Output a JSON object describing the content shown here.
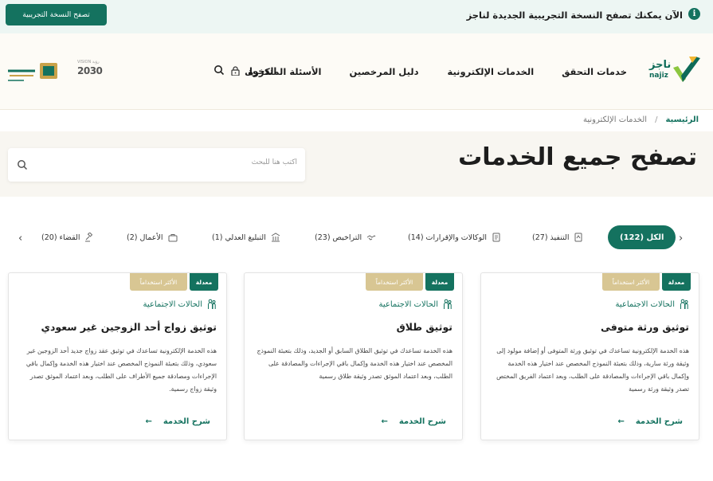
{
  "banner": {
    "text": "الآن يمكنك تصفح النسخة التجريبية الجديدة لناجز",
    "button": "تصفح النسخة التجريبية",
    "info_icon": "info-icon"
  },
  "header": {
    "logo_text": "ناجز",
    "logo_sub": "najiz",
    "nav": [
      "خدمات التحقق",
      "الخدمات الإلكترونية",
      "دليل المرخصين",
      "الأسئلة المتكررة"
    ],
    "login": "الدخول",
    "vision_label": "VISION رؤية",
    "vision_year": "2030",
    "colors": {
      "primary": "#14725f",
      "gold": "#d8c693"
    }
  },
  "breadcrumb": {
    "home": "الرئيسية",
    "separator": "/",
    "current": "الخدمات الإلكترونية"
  },
  "hero": {
    "title": "تصفح جميع الخدمات",
    "search_placeholder": "اكتب هنا للبحث"
  },
  "filters": [
    {
      "label": "الكل (122)",
      "active": true
    },
    {
      "label": "التنفيذ (27)",
      "icon": "execution-icon"
    },
    {
      "label": "الوكالات والإقرارات (14)",
      "icon": "document-icon"
    },
    {
      "label": "التراخيص (23)",
      "icon": "handshake-icon"
    },
    {
      "label": "التبليغ العدلي (1)",
      "icon": "building-icon"
    },
    {
      "label": "الأعمال (2)",
      "icon": "briefcase-icon"
    },
    {
      "label": "القضاء (20)",
      "icon": "gavel-icon"
    }
  ],
  "cards": [
    {
      "badge_modified": "معدلة",
      "badge_most": "الأكثر استخداماً",
      "category": "الحالات الاجتماعية",
      "title": "توثيق ورثة متوفى",
      "description": "هذه الخدمة الإلكترونية تساعدك في توثيق ورثة المتوفى أو إضافة مولود إلى وثيقة ورثة سارية، وذلك بتعبئة النموذج المخصص عند اختيار هذه الخدمة وإكمال باقي الإجراءات والمصادقة على الطلب، وبعد اعتماد الفريق المختص تصدر وثيقة ورثة رسمية",
      "link": "شرح الخدمة"
    },
    {
      "badge_modified": "معدلة",
      "badge_most": "الأكثر استخداماً",
      "category": "الحالات الاجتماعية",
      "title": "توثيق طلاق",
      "description": "هذه الخدمة تساعدك في توثيق الطلاق السابق أو الجديد، وذلك بتعبئة النموذج المخصص عند اختيار هذه الخدمة وإكمال باقي الإجراءات والمصادقة على الطلب، وبعد اعتماد الموثق تصدر وثيقة طلاق رسمية",
      "link": "شرح الخدمة"
    },
    {
      "badge_modified": "معدلة",
      "badge_most": "الأكثر استخداماً",
      "category": "الحالات الاجتماعية",
      "title": "توثيق زواج أحد الزوجين غير سعودي",
      "description": "هذه الخدمة الإلكترونية تساعدك في توثيق عقد زواج جديد أحد الزوجين غير سعودي، وذلك بتعبئة النموذج المخصص عند اختيار هذه الخدمة وإكمال باقي الإجراءات ومصادقة جميع الأطراف على الطلب، وبعد اعتماد الموثق تصدر وثيقة زواج رسمية.",
      "link": "شرح الخدمة"
    }
  ]
}
